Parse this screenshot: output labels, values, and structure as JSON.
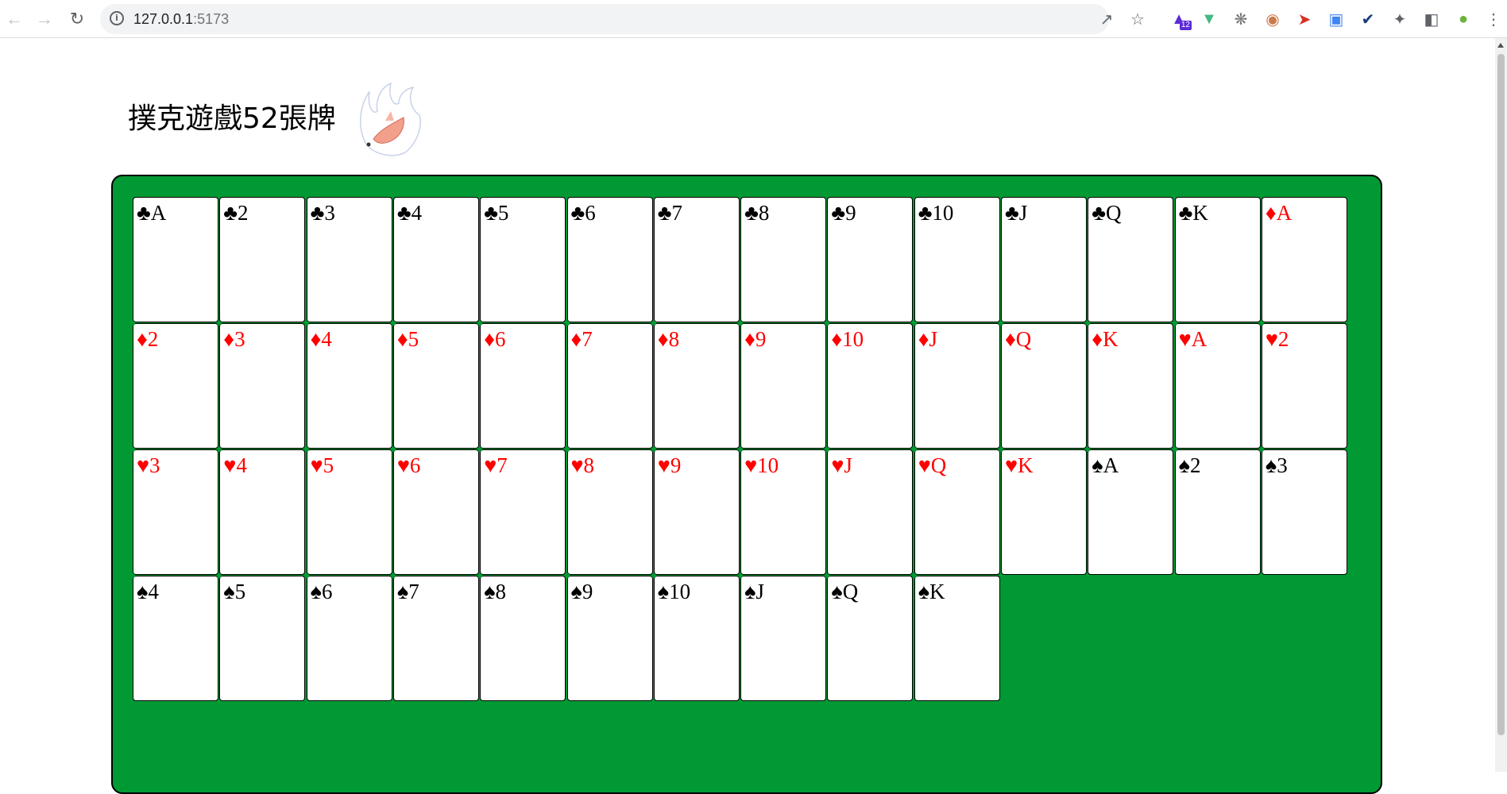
{
  "browser": {
    "url_host": "127.0.0.1",
    "url_port": ":5173",
    "extension_badge": "12"
  },
  "page": {
    "title": "撲克遊戲52張牌"
  },
  "colors": {
    "table_green": "#009933",
    "red_suit": "#ff0000",
    "black_suit": "#000000"
  },
  "cards": [
    {
      "suit": "♣",
      "rank": "A",
      "color": "black"
    },
    {
      "suit": "♣",
      "rank": "2",
      "color": "black"
    },
    {
      "suit": "♣",
      "rank": "3",
      "color": "black"
    },
    {
      "suit": "♣",
      "rank": "4",
      "color": "black"
    },
    {
      "suit": "♣",
      "rank": "5",
      "color": "black"
    },
    {
      "suit": "♣",
      "rank": "6",
      "color": "black"
    },
    {
      "suit": "♣",
      "rank": "7",
      "color": "black"
    },
    {
      "suit": "♣",
      "rank": "8",
      "color": "black"
    },
    {
      "suit": "♣",
      "rank": "9",
      "color": "black"
    },
    {
      "suit": "♣",
      "rank": "10",
      "color": "black"
    },
    {
      "suit": "♣",
      "rank": "J",
      "color": "black"
    },
    {
      "suit": "♣",
      "rank": "Q",
      "color": "black"
    },
    {
      "suit": "♣",
      "rank": "K",
      "color": "black"
    },
    {
      "suit": "♦",
      "rank": "A",
      "color": "red"
    },
    {
      "suit": "♦",
      "rank": "2",
      "color": "red"
    },
    {
      "suit": "♦",
      "rank": "3",
      "color": "red"
    },
    {
      "suit": "♦",
      "rank": "4",
      "color": "red"
    },
    {
      "suit": "♦",
      "rank": "5",
      "color": "red"
    },
    {
      "suit": "♦",
      "rank": "6",
      "color": "red"
    },
    {
      "suit": "♦",
      "rank": "7",
      "color": "red"
    },
    {
      "suit": "♦",
      "rank": "8",
      "color": "red"
    },
    {
      "suit": "♦",
      "rank": "9",
      "color": "red"
    },
    {
      "suit": "♦",
      "rank": "10",
      "color": "red"
    },
    {
      "suit": "♦",
      "rank": "J",
      "color": "red"
    },
    {
      "suit": "♦",
      "rank": "Q",
      "color": "red"
    },
    {
      "suit": "♦",
      "rank": "K",
      "color": "red"
    },
    {
      "suit": "♥",
      "rank": "A",
      "color": "red"
    },
    {
      "suit": "♥",
      "rank": "2",
      "color": "red"
    },
    {
      "suit": "♥",
      "rank": "3",
      "color": "red"
    },
    {
      "suit": "♥",
      "rank": "4",
      "color": "red"
    },
    {
      "suit": "♥",
      "rank": "5",
      "color": "red"
    },
    {
      "suit": "♥",
      "rank": "6",
      "color": "red"
    },
    {
      "suit": "♥",
      "rank": "7",
      "color": "red"
    },
    {
      "suit": "♥",
      "rank": "8",
      "color": "red"
    },
    {
      "suit": "♥",
      "rank": "9",
      "color": "red"
    },
    {
      "suit": "♥",
      "rank": "10",
      "color": "red"
    },
    {
      "suit": "♥",
      "rank": "J",
      "color": "red"
    },
    {
      "suit": "♥",
      "rank": "Q",
      "color": "red"
    },
    {
      "suit": "♥",
      "rank": "K",
      "color": "red"
    },
    {
      "suit": "♠",
      "rank": "A",
      "color": "black"
    },
    {
      "suit": "♠",
      "rank": "2",
      "color": "black"
    },
    {
      "suit": "♠",
      "rank": "3",
      "color": "black"
    },
    {
      "suit": "♠",
      "rank": "4",
      "color": "black"
    },
    {
      "suit": "♠",
      "rank": "5",
      "color": "black"
    },
    {
      "suit": "♠",
      "rank": "6",
      "color": "black"
    },
    {
      "suit": "♠",
      "rank": "7",
      "color": "black"
    },
    {
      "suit": "♠",
      "rank": "8",
      "color": "black"
    },
    {
      "suit": "♠",
      "rank": "9",
      "color": "black"
    },
    {
      "suit": "♠",
      "rank": "10",
      "color": "black"
    },
    {
      "suit": "♠",
      "rank": "J",
      "color": "black"
    },
    {
      "suit": "♠",
      "rank": "Q",
      "color": "black"
    },
    {
      "suit": "♠",
      "rank": "K",
      "color": "black"
    }
  ]
}
